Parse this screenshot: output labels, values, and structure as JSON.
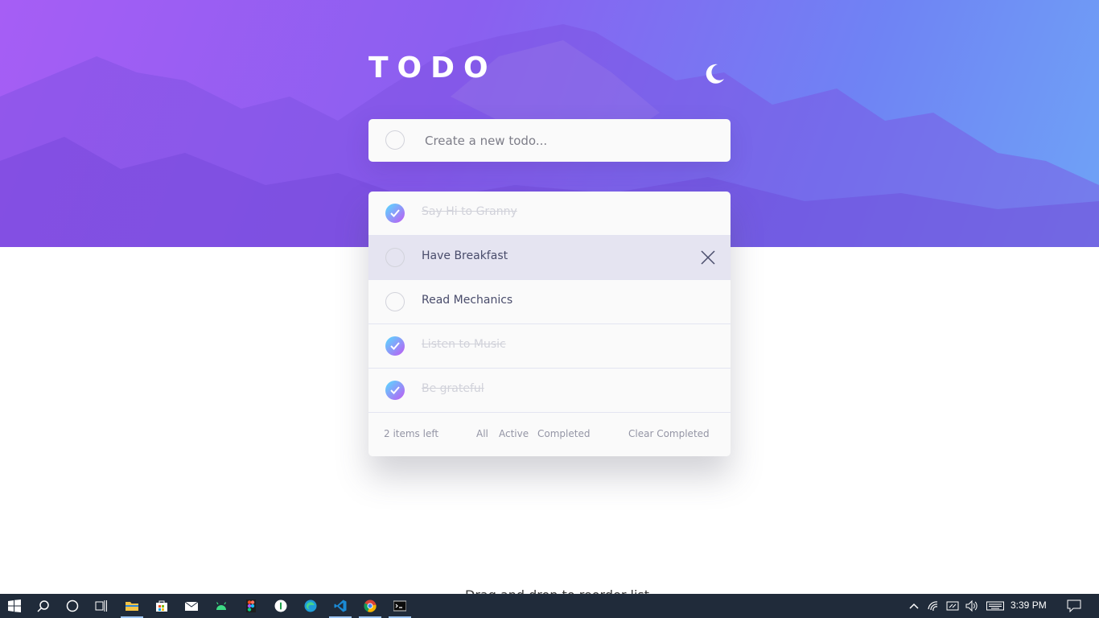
{
  "header": {
    "title": "TODO",
    "theme_icon": "moon-icon"
  },
  "new_todo": {
    "placeholder": "Create a new todo..."
  },
  "todos": [
    {
      "text": "Say Hi to Granny",
      "completed": true
    },
    {
      "text": "Have Breakfast",
      "completed": false
    },
    {
      "text": "Read Mechanics",
      "completed": false
    },
    {
      "text": "Listen to Music",
      "completed": true
    },
    {
      "text": "Be grateful",
      "completed": true
    }
  ],
  "footer": {
    "items_left": "2 items left",
    "filters": [
      "All",
      "Active",
      "Completed"
    ],
    "clear": "Clear Completed"
  },
  "partial_text": "Drag and drop to reorder list",
  "taskbar": {
    "icons": [
      "windows-start-icon",
      "search-icon",
      "cortana-icon",
      "task-view-icon",
      "file-explorer-icon",
      "store-icon",
      "mail-icon",
      "android-studio-icon",
      "figma-icon",
      "app-icon",
      "edge-icon",
      "vscode-icon",
      "chrome-icon",
      "terminal-icon"
    ],
    "tray_icons": [
      "chevron-up-icon",
      "wifi-icon",
      "ime-icon",
      "volume-icon",
      "keyboard-icon",
      "notification-icon"
    ],
    "time": "3:39 PM"
  },
  "colors": {
    "accent_gradient_start": "#55ddff",
    "accent_gradient_end": "#c058f3",
    "hero_left": "#a65ef5",
    "hero_right": "#6fa3f6"
  }
}
